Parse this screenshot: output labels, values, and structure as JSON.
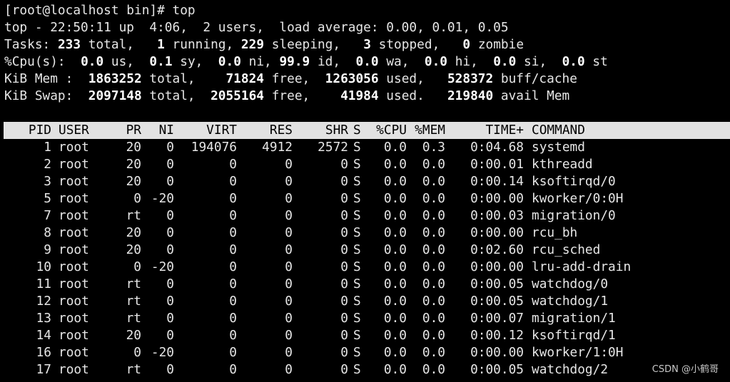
{
  "prompt": "[root@localhost bin]# top",
  "summary": {
    "uptime_line": "top - 22:50:11 up  4:06,  2 users,  load average: 0.00, 0.01, 0.05",
    "tasks": {
      "label": "Tasks: ",
      "total": "233",
      "total_label": " total,   ",
      "running": "1",
      "running_label": " running, ",
      "sleeping": "229",
      "sleeping_label": " sleeping,   ",
      "stopped": "3",
      "stopped_label": " stopped,   ",
      "zombie": "0",
      "zombie_label": " zombie"
    },
    "cpu": {
      "label": "%Cpu(s):  ",
      "us": "0.0",
      "us_label": " us,  ",
      "sy": "0.1",
      "sy_label": " sy,  ",
      "ni": "0.0",
      "ni_label": " ni, ",
      "id": "99.9",
      "id_label": " id,  ",
      "wa": "0.0",
      "wa_label": " wa,  ",
      "hi": "0.0",
      "hi_label": " hi,  ",
      "si": "0.0",
      "si_label": " si,  ",
      "st": "0.0",
      "st_label": " st"
    },
    "mem": {
      "label": "KiB Mem :  ",
      "total": "1863252",
      "total_label": " total,    ",
      "free": "71824",
      "free_label": " free,  ",
      "used": "1263056",
      "used_label": " used,   ",
      "buff": "528372",
      "buff_label": " buff/cache"
    },
    "swap": {
      "label": "KiB Swap:  ",
      "total": "2097148",
      "total_label": " total,  ",
      "free": "2055164",
      "free_label": " free,    ",
      "used": "41984",
      "used_label": " used.   ",
      "avail": "219840",
      "avail_label": " avail Mem"
    }
  },
  "table": {
    "headers": {
      "pid": "PID",
      "user": "USER",
      "pr": "PR",
      "ni": "NI",
      "virt": "VIRT",
      "res": "RES",
      "shr": "SHR",
      "s": "S",
      "cpu": "%CPU",
      "mem": "%MEM",
      "time": "TIME+",
      "command": "COMMAND"
    },
    "rows": [
      {
        "pid": "1",
        "user": "root",
        "pr": "20",
        "ni": "0",
        "virt": "194076",
        "res": "4912",
        "shr": "2572",
        "s": "S",
        "cpu": "0.0",
        "mem": "0.3",
        "time": "0:04.68",
        "command": "systemd"
      },
      {
        "pid": "2",
        "user": "root",
        "pr": "20",
        "ni": "0",
        "virt": "0",
        "res": "0",
        "shr": "0",
        "s": "S",
        "cpu": "0.0",
        "mem": "0.0",
        "time": "0:00.01",
        "command": "kthreadd"
      },
      {
        "pid": "3",
        "user": "root",
        "pr": "20",
        "ni": "0",
        "virt": "0",
        "res": "0",
        "shr": "0",
        "s": "S",
        "cpu": "0.0",
        "mem": "0.0",
        "time": "0:00.14",
        "command": "ksoftirqd/0"
      },
      {
        "pid": "5",
        "user": "root",
        "pr": "0",
        "ni": "-20",
        "virt": "0",
        "res": "0",
        "shr": "0",
        "s": "S",
        "cpu": "0.0",
        "mem": "0.0",
        "time": "0:00.00",
        "command": "kworker/0:0H"
      },
      {
        "pid": "7",
        "user": "root",
        "pr": "rt",
        "ni": "0",
        "virt": "0",
        "res": "0",
        "shr": "0",
        "s": "S",
        "cpu": "0.0",
        "mem": "0.0",
        "time": "0:00.03",
        "command": "migration/0"
      },
      {
        "pid": "8",
        "user": "root",
        "pr": "20",
        "ni": "0",
        "virt": "0",
        "res": "0",
        "shr": "0",
        "s": "S",
        "cpu": "0.0",
        "mem": "0.0",
        "time": "0:00.00",
        "command": "rcu_bh"
      },
      {
        "pid": "9",
        "user": "root",
        "pr": "20",
        "ni": "0",
        "virt": "0",
        "res": "0",
        "shr": "0",
        "s": "S",
        "cpu": "0.0",
        "mem": "0.0",
        "time": "0:02.60",
        "command": "rcu_sched"
      },
      {
        "pid": "10",
        "user": "root",
        "pr": "0",
        "ni": "-20",
        "virt": "0",
        "res": "0",
        "shr": "0",
        "s": "S",
        "cpu": "0.0",
        "mem": "0.0",
        "time": "0:00.00",
        "command": "lru-add-drain"
      },
      {
        "pid": "11",
        "user": "root",
        "pr": "rt",
        "ni": "0",
        "virt": "0",
        "res": "0",
        "shr": "0",
        "s": "S",
        "cpu": "0.0",
        "mem": "0.0",
        "time": "0:00.05",
        "command": "watchdog/0"
      },
      {
        "pid": "12",
        "user": "root",
        "pr": "rt",
        "ni": "0",
        "virt": "0",
        "res": "0",
        "shr": "0",
        "s": "S",
        "cpu": "0.0",
        "mem": "0.0",
        "time": "0:00.05",
        "command": "watchdog/1"
      },
      {
        "pid": "13",
        "user": "root",
        "pr": "rt",
        "ni": "0",
        "virt": "0",
        "res": "0",
        "shr": "0",
        "s": "S",
        "cpu": "0.0",
        "mem": "0.0",
        "time": "0:00.07",
        "command": "migration/1"
      },
      {
        "pid": "14",
        "user": "root",
        "pr": "20",
        "ni": "0",
        "virt": "0",
        "res": "0",
        "shr": "0",
        "s": "S",
        "cpu": "0.0",
        "mem": "0.0",
        "time": "0:00.12",
        "command": "ksoftirqd/1"
      },
      {
        "pid": "16",
        "user": "root",
        "pr": "0",
        "ni": "-20",
        "virt": "0",
        "res": "0",
        "shr": "0",
        "s": "S",
        "cpu": "0.0",
        "mem": "0.0",
        "time": "0:00.00",
        "command": "kworker/1:0H"
      },
      {
        "pid": "17",
        "user": "root",
        "pr": "rt",
        "ni": "0",
        "virt": "0",
        "res": "0",
        "shr": "0",
        "s": "S",
        "cpu": "0.0",
        "mem": "0.0",
        "time": "0:00.05",
        "command": "watchdog/2"
      }
    ]
  },
  "watermark": "CSDN @小鹤哥",
  "colors": {
    "background": "#000000",
    "foreground": "#e6e6e6",
    "header_bar": "#e2e2e2",
    "header_text": "#000000"
  }
}
